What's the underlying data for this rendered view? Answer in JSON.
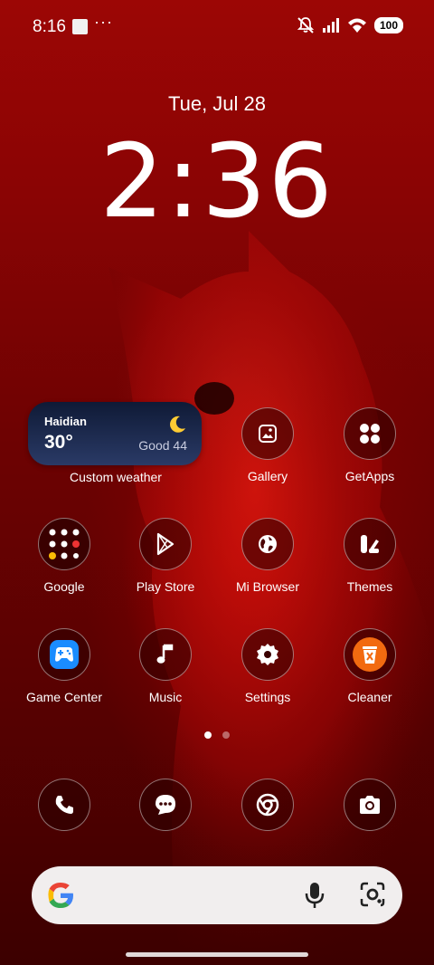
{
  "status_bar": {
    "time": "8:16",
    "overflow": "···",
    "battery": "100",
    "icons": [
      "silent-bell-icon",
      "signal-icon",
      "wifi-icon",
      "battery-icon"
    ]
  },
  "lock": {
    "date": "Tue, Jul 28",
    "time": "2:36"
  },
  "weather": {
    "city": "Haidian",
    "temperature": "30°",
    "air_quality": "Good 44",
    "label": "Custom weather",
    "icon": "moon-icon"
  },
  "apps": [
    {
      "label": "Gallery",
      "icon": "gallery-icon"
    },
    {
      "label": "GetApps",
      "icon": "getapps-icon"
    },
    {
      "label": "Google",
      "icon": "google-folder-icon"
    },
    {
      "label": "Play Store",
      "icon": "play-store-icon"
    },
    {
      "label": "Mi Browser",
      "icon": "globe-icon"
    },
    {
      "label": "Themes",
      "icon": "themes-icon"
    },
    {
      "label": "Game Center",
      "icon": "gamepad-icon"
    },
    {
      "label": "Music",
      "icon": "music-note-icon"
    },
    {
      "label": "Settings",
      "icon": "gear-icon"
    },
    {
      "label": "Cleaner",
      "icon": "trash-icon"
    }
  ],
  "page_indicator": {
    "pages": 2,
    "active": 1
  },
  "dock": [
    "phone-icon",
    "messages-icon",
    "chrome-icon",
    "camera-icon"
  ],
  "search": {
    "icons": [
      "google-g-icon",
      "mic-icon",
      "lens-icon"
    ]
  },
  "colors": {
    "accent_red": "#8a0404",
    "weather_bg": "#1b2748",
    "cleaner_orange": "#f26a10",
    "game_blue": "#1a8cff"
  }
}
